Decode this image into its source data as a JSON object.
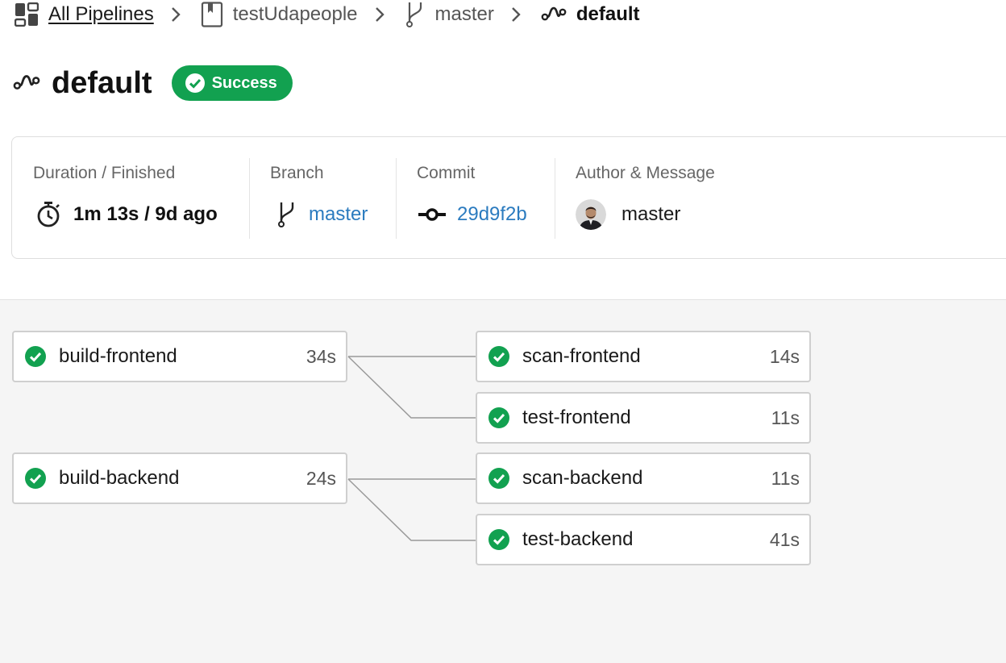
{
  "breadcrumb": {
    "all_pipelines": "All Pipelines",
    "project": "testUdapeople",
    "branch": "master",
    "workflow": "default",
    "icons": [
      "dashboard-icon",
      "repo-bookmark-icon",
      "branch-icon",
      "workflow-icon"
    ]
  },
  "header": {
    "title": "default",
    "status": "Success",
    "status_color": "#12a150"
  },
  "summary": {
    "duration": {
      "label": "Duration / Finished",
      "value": "1m 13s / 9d ago"
    },
    "branch": {
      "label": "Branch",
      "value": "master"
    },
    "commit": {
      "label": "Commit",
      "value": "29d9f2b"
    },
    "author": {
      "label": "Author & Message",
      "value": "master"
    }
  },
  "jobs": [
    {
      "name": "build-frontend",
      "duration": "34s",
      "status": "success"
    },
    {
      "name": "scan-frontend",
      "duration": "14s",
      "status": "success"
    },
    {
      "name": "test-frontend",
      "duration": "11s",
      "status": "success"
    },
    {
      "name": "build-backend",
      "duration": "24s",
      "status": "success"
    },
    {
      "name": "scan-backend",
      "duration": "11s",
      "status": "success"
    },
    {
      "name": "test-backend",
      "duration": "41s",
      "status": "success"
    }
  ],
  "colors": {
    "success": "#12a150",
    "link": "#2b7bbf"
  }
}
